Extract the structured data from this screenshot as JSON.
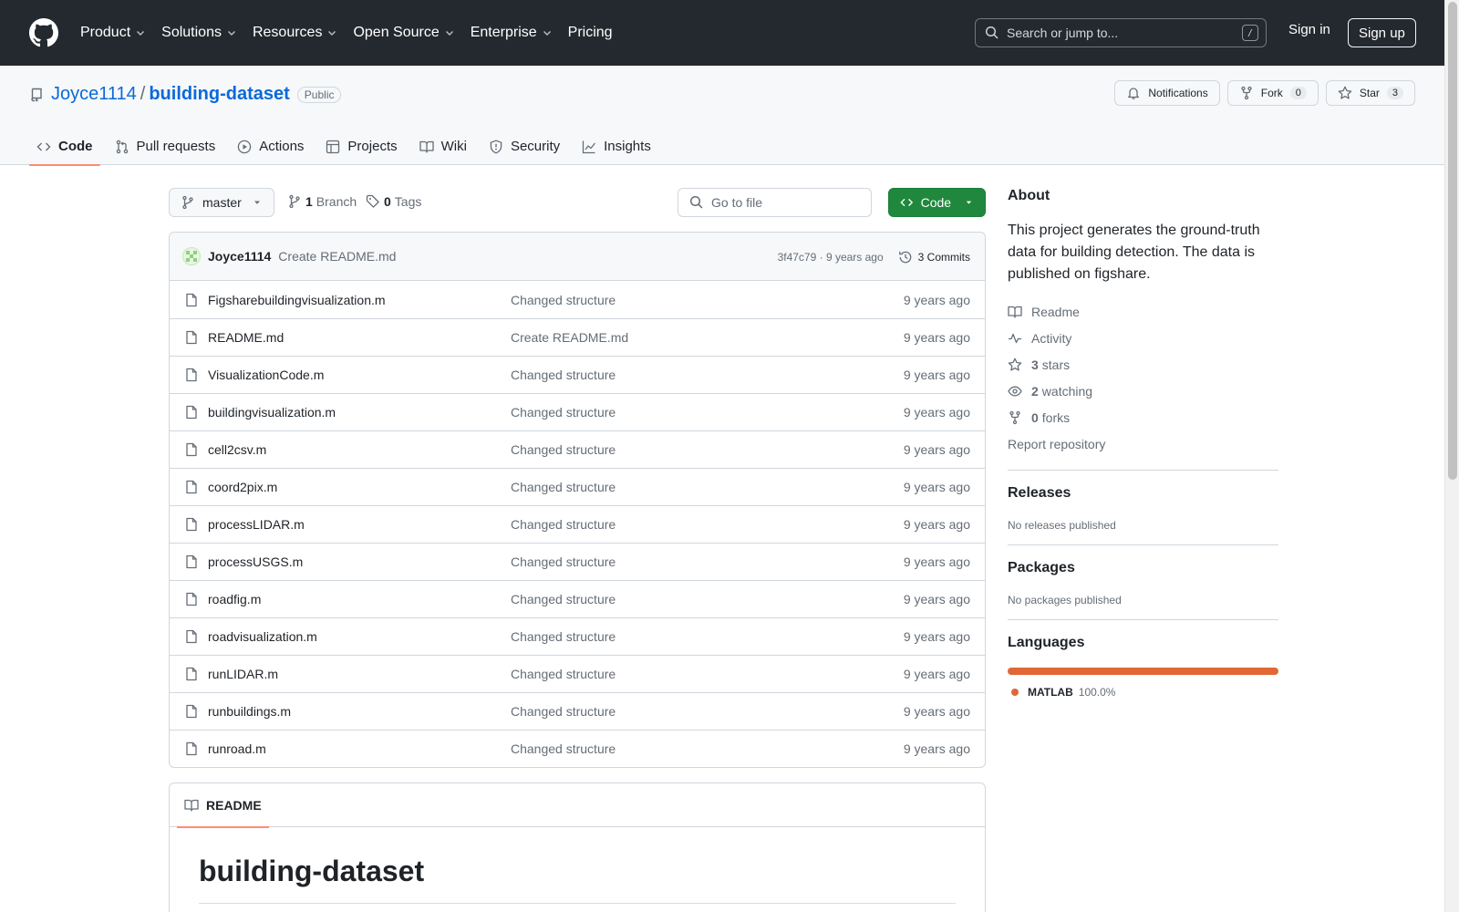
{
  "topnav": {
    "items": [
      "Product",
      "Solutions",
      "Resources",
      "Open Source",
      "Enterprise",
      "Pricing"
    ],
    "search_placeholder": "Search or jump to...",
    "search_key": "/",
    "signin": "Sign in",
    "signup": "Sign up"
  },
  "repo": {
    "owner": "Joyce1114",
    "separator": "/",
    "name": "building-dataset",
    "visibility": "Public",
    "notifications_label": "Notifications",
    "fork_label": "Fork",
    "fork_count": "0",
    "star_label": "Star",
    "star_count": "3"
  },
  "tabs": [
    "Code",
    "Pull requests",
    "Actions",
    "Projects",
    "Wiki",
    "Security",
    "Insights"
  ],
  "branchbar": {
    "branch": "master",
    "branch_count": "1",
    "branch_label": "Branch",
    "tag_count": "0",
    "tag_label": "Tags",
    "goto_placeholder": "Go to file",
    "code_label": "Code"
  },
  "commit": {
    "author": "Joyce1114",
    "message": "Create README.md",
    "hash_time": "3f47c79 · 9 years ago",
    "commits": "3 Commits"
  },
  "files": [
    {
      "name": "Figsharebuildingvisualization.m",
      "msg": "Changed structure",
      "age": "9 years ago"
    },
    {
      "name": "README.md",
      "msg": "Create README.md",
      "age": "9 years ago"
    },
    {
      "name": "VisualizationCode.m",
      "msg": "Changed structure",
      "age": "9 years ago"
    },
    {
      "name": "buildingvisualization.m",
      "msg": "Changed structure",
      "age": "9 years ago"
    },
    {
      "name": "cell2csv.m",
      "msg": "Changed structure",
      "age": "9 years ago"
    },
    {
      "name": "coord2pix.m",
      "msg": "Changed structure",
      "age": "9 years ago"
    },
    {
      "name": "processLIDAR.m",
      "msg": "Changed structure",
      "age": "9 years ago"
    },
    {
      "name": "processUSGS.m",
      "msg": "Changed structure",
      "age": "9 years ago"
    },
    {
      "name": "roadfig.m",
      "msg": "Changed structure",
      "age": "9 years ago"
    },
    {
      "name": "roadvisualization.m",
      "msg": "Changed structure",
      "age": "9 years ago"
    },
    {
      "name": "runLIDAR.m",
      "msg": "Changed structure",
      "age": "9 years ago"
    },
    {
      "name": "runbuildings.m",
      "msg": "Changed structure",
      "age": "9 years ago"
    },
    {
      "name": "runroad.m",
      "msg": "Changed structure",
      "age": "9 years ago"
    }
  ],
  "readme": {
    "tab": "README",
    "title": "building-dataset"
  },
  "sidebar": {
    "about_title": "About",
    "about_text": "This project generates the ground-truth data for building detection. The data is published on figshare.",
    "readme": "Readme",
    "activity": "Activity",
    "stars_count": "3",
    "stars_label": "stars",
    "watching_count": "2",
    "watching_label": "watching",
    "forks_count": "0",
    "forks_label": "forks",
    "report": "Report repository",
    "releases_title": "Releases",
    "releases_text": "No releases published",
    "packages_title": "Packages",
    "packages_text": "No packages published",
    "languages_title": "Languages",
    "language_name": "MATLAB",
    "language_pct": "100.0%",
    "language_color": "#e16737"
  },
  "colors": {
    "header_bg": "#24292f",
    "link": "#0969da",
    "code_button": "#1f883d",
    "tab_underline": "#fd8c73"
  }
}
